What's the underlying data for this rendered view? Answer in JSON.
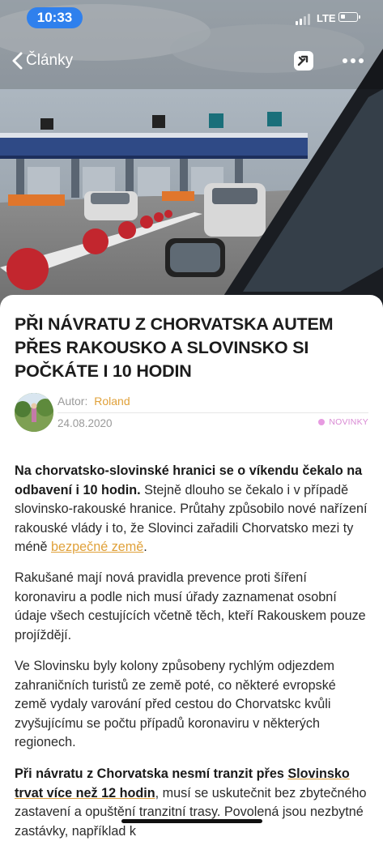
{
  "status_bar": {
    "time": "10:33",
    "network": "LTE"
  },
  "nav": {
    "back_label": "Články",
    "icons": {
      "back": "chevron-left-icon",
      "share": "share-icon",
      "more": "more-icon"
    }
  },
  "hero": {
    "description_icon": "border-toll-booths-image"
  },
  "article": {
    "headline": "PŘI NÁVRATU Z CHORVATSKA AUTEM PŘES RAKOUSKO A SLOVINSKO SI POČKÁTE I 10 HODIN",
    "author_label": "Autor:",
    "author_name": "Roland",
    "date": "24.08.2020",
    "category": "NOVINKY",
    "paragraph1": {
      "bold": "Na chorvatsko-slovinské hranici se o víkendu čekalo na odbavení i 10 hodin.",
      "text": " Stejně dlouho se čekalo i v případě slovinsko-rakouské hranice. Průtahy způsobilo nové nařízení rakouské vlády i to, že Slovinci zařadili Chorvatsko mezi ty méně ",
      "link": "bezpečné země",
      "after": "."
    },
    "paragraph2": "Rakušané mají nová pravidla prevence proti šíření koronaviru a podle nich musí úřady zaznamenat osobní údaje všech cestujících včetně těch, kteří Rakouskem pouze projíždějí.",
    "paragraph3": "Ve Slovinsku byly kolony způsobeny rychlým odjezdem zahraničních turistů ze země poté, co některé evropské země vydaly varování před cestou do Chorvatskc kvůli zvyšujícímu se počtu případů koronaviru v některých regionech.",
    "paragraph4": {
      "bold_start": "Při návratu z Chorvatska nesmí tranzit přes ",
      "link": "Slovinsko trvat více než 12 hodin",
      "text": ", musí se uskutečnit bez zbytečného zastavení a opuštění tranzitní trasy. Povolená jsou nezbytné zastávky, například k"
    }
  },
  "colors": {
    "accent": "#e0a13a",
    "status_pill": "#2f80ed",
    "category": "#d98ad4"
  }
}
